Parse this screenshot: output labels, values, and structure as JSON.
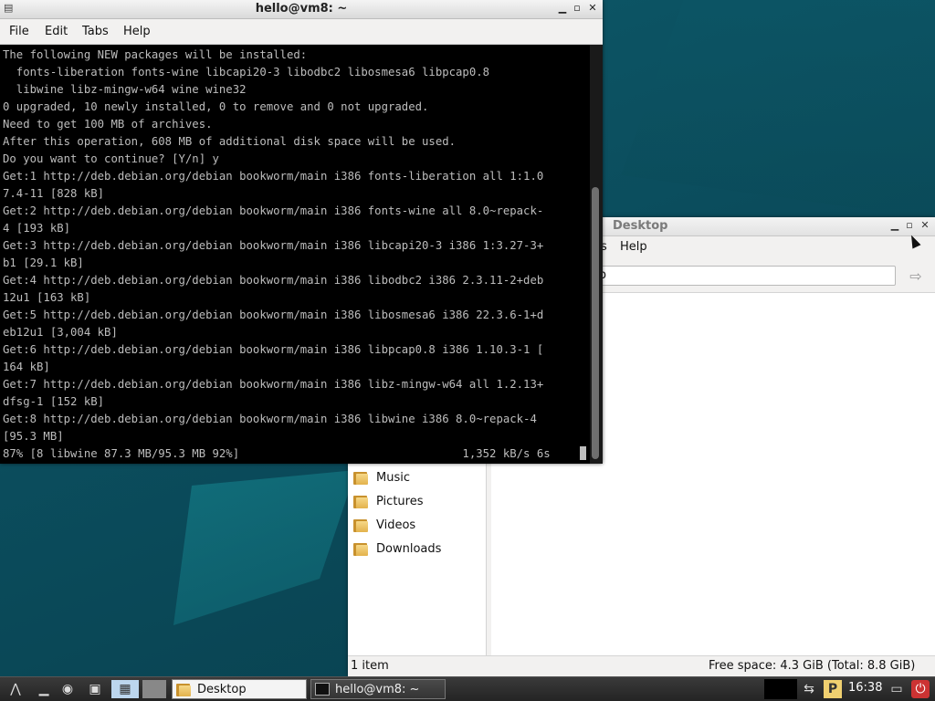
{
  "terminal": {
    "title": "hello@vm8: ~",
    "menu": [
      "File",
      "Edit",
      "Tabs",
      "Help"
    ],
    "lines": [
      "The following NEW packages will be installed:",
      "  fonts-liberation fonts-wine libcapi20-3 libodbc2 libosmesa6 libpcap0.8",
      "  libwine libz-mingw-w64 wine wine32",
      "0 upgraded, 10 newly installed, 0 to remove and 0 not upgraded.",
      "Need to get 100 MB of archives.",
      "After this operation, 608 MB of additional disk space will be used.",
      "Do you want to continue? [Y/n] y",
      "Get:1 http://deb.debian.org/debian bookworm/main i386 fonts-liberation all 1:1.0",
      "7.4-11 [828 kB]",
      "Get:2 http://deb.debian.org/debian bookworm/main i386 fonts-wine all 8.0~repack-",
      "4 [193 kB]",
      "Get:3 http://deb.debian.org/debian bookworm/main i386 libcapi20-3 i386 1:3.27-3+",
      "b1 [29.1 kB]",
      "Get:4 http://deb.debian.org/debian bookworm/main i386 libodbc2 i386 2.3.11-2+deb",
      "12u1 [163 kB]",
      "Get:5 http://deb.debian.org/debian bookworm/main i386 libosmesa6 i386 22.3.6-1+d",
      "eb12u1 [3,004 kB]",
      "Get:6 http://deb.debian.org/debian bookworm/main i386 libpcap0.8 i386 1.10.3-1 [",
      "164 kB]",
      "Get:7 http://deb.debian.org/debian bookworm/main i386 libz-mingw-w64 all 1.2.13+",
      "dfsg-1 [152 kB]",
      "Get:8 http://deb.debian.org/debian bookworm/main i386 libwine i386 8.0~repack-4",
      "[95.3 MB]",
      "87% [8 libwine 87.3 MB/95.3 MB 92%]                                 1,352 kB/s 6s"
    ]
  },
  "file_manager": {
    "title": "Desktop",
    "menu_partial": "s",
    "menu_help": "Help",
    "location": "/Desktop",
    "sidebar": [
      "Music",
      "Pictures",
      "Videos",
      "Downloads"
    ],
    "status_items": "1 item",
    "status_space": "Free space: 4.3 GiB (Total: 8.8 GiB)"
  },
  "taskbar": {
    "tasks": [
      {
        "label": "Desktop",
        "icon": "folder-icon",
        "active": true
      },
      {
        "label": "hello@vm8: ~",
        "icon": "terminal-icon",
        "active": false
      }
    ],
    "clock": "16:38"
  },
  "colors": {
    "terminal_fg": "#bdbdbd",
    "desktop_bg": "#0b4d5d"
  }
}
